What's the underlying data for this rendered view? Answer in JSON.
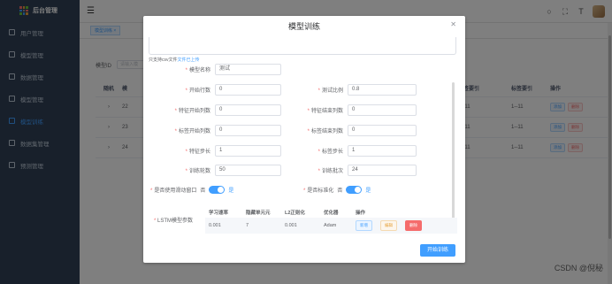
{
  "app": {
    "title": "后台管理",
    "logo_colors": [
      "#f56c6c",
      "#e6a23c",
      "#67c23a",
      "#409eff",
      "#909399",
      "#f56c6c",
      "#67c23a",
      "#409eff",
      "#e6a23c"
    ]
  },
  "sidebar": {
    "items": [
      {
        "label": "用户管理",
        "icon": "user-icon"
      },
      {
        "label": "模型管理",
        "icon": "model-icon"
      },
      {
        "label": "数据管理",
        "icon": "data-icon"
      },
      {
        "label": "模型管理",
        "icon": "settings-icon"
      },
      {
        "label": "模型训练",
        "icon": "train-icon",
        "active": true
      },
      {
        "label": "数据集管理",
        "icon": "dataset-icon"
      },
      {
        "label": "预测管理",
        "icon": "predict-icon"
      }
    ]
  },
  "tags": {
    "active": "模型训练 ×"
  },
  "filter": {
    "label": "模型ID",
    "placeholder": "请输入模"
  },
  "background_table": {
    "headers": [
      "随机",
      "模",
      "",
      "标签要引",
      "标签要引",
      "操作"
    ],
    "rows": [
      {
        "idx": "›",
        "id": "22",
        "a": "1--11",
        "b": "1--11"
      },
      {
        "idx": "›",
        "id": "23",
        "a": "1--11",
        "b": "1--11"
      },
      {
        "idx": "›",
        "id": "24",
        "a": "1--11",
        "b": "1--11"
      }
    ],
    "edit_label": "添加",
    "delete_label": "删除"
  },
  "dialog": {
    "title": "模型训练",
    "upload_tip": "只支持csv文件",
    "upload_done": "文件已上传",
    "fields": {
      "model_name": {
        "label": "模型名称",
        "value": "测试"
      },
      "start_row": {
        "label": "开始行数",
        "value": "0"
      },
      "test_ratio": {
        "label": "测试比例",
        "value": "0.8"
      },
      "feature_start_col": {
        "label": "特征开始列数",
        "value": "0"
      },
      "feature_end_col": {
        "label": "特征结束列数",
        "value": "0"
      },
      "label_start_col": {
        "label": "标签开始列数",
        "value": "0"
      },
      "label_end_col": {
        "label": "标签结束列数",
        "value": "0"
      },
      "feature_step": {
        "label": "特征步长",
        "value": "1"
      },
      "label_step": {
        "label": "标签步长",
        "value": "1"
      },
      "epochs": {
        "label": "训练轮数",
        "value": "50"
      },
      "batch": {
        "label": "训练批次",
        "value": "24"
      }
    },
    "sliding_window": {
      "label": "是否使用滑动窗口",
      "off": "否",
      "on": "是",
      "checked": true
    },
    "normalize": {
      "label": "是否标准化",
      "off": "否",
      "on": "是",
      "checked": true
    },
    "lstm": {
      "label": "LSTM模型参数",
      "headers": [
        "学习速率",
        "隐藏单元元",
        "L2正则化",
        "优化器",
        "操作"
      ],
      "row": {
        "lr": "0.001",
        "hidden": "7",
        "l2": "0.001",
        "optimizer": "Adam"
      },
      "add_label": "新增",
      "edit_label": "编辑",
      "delete_label": "删除"
    },
    "start_button": "开始训练"
  },
  "watermark": "CSDN @倪秘"
}
